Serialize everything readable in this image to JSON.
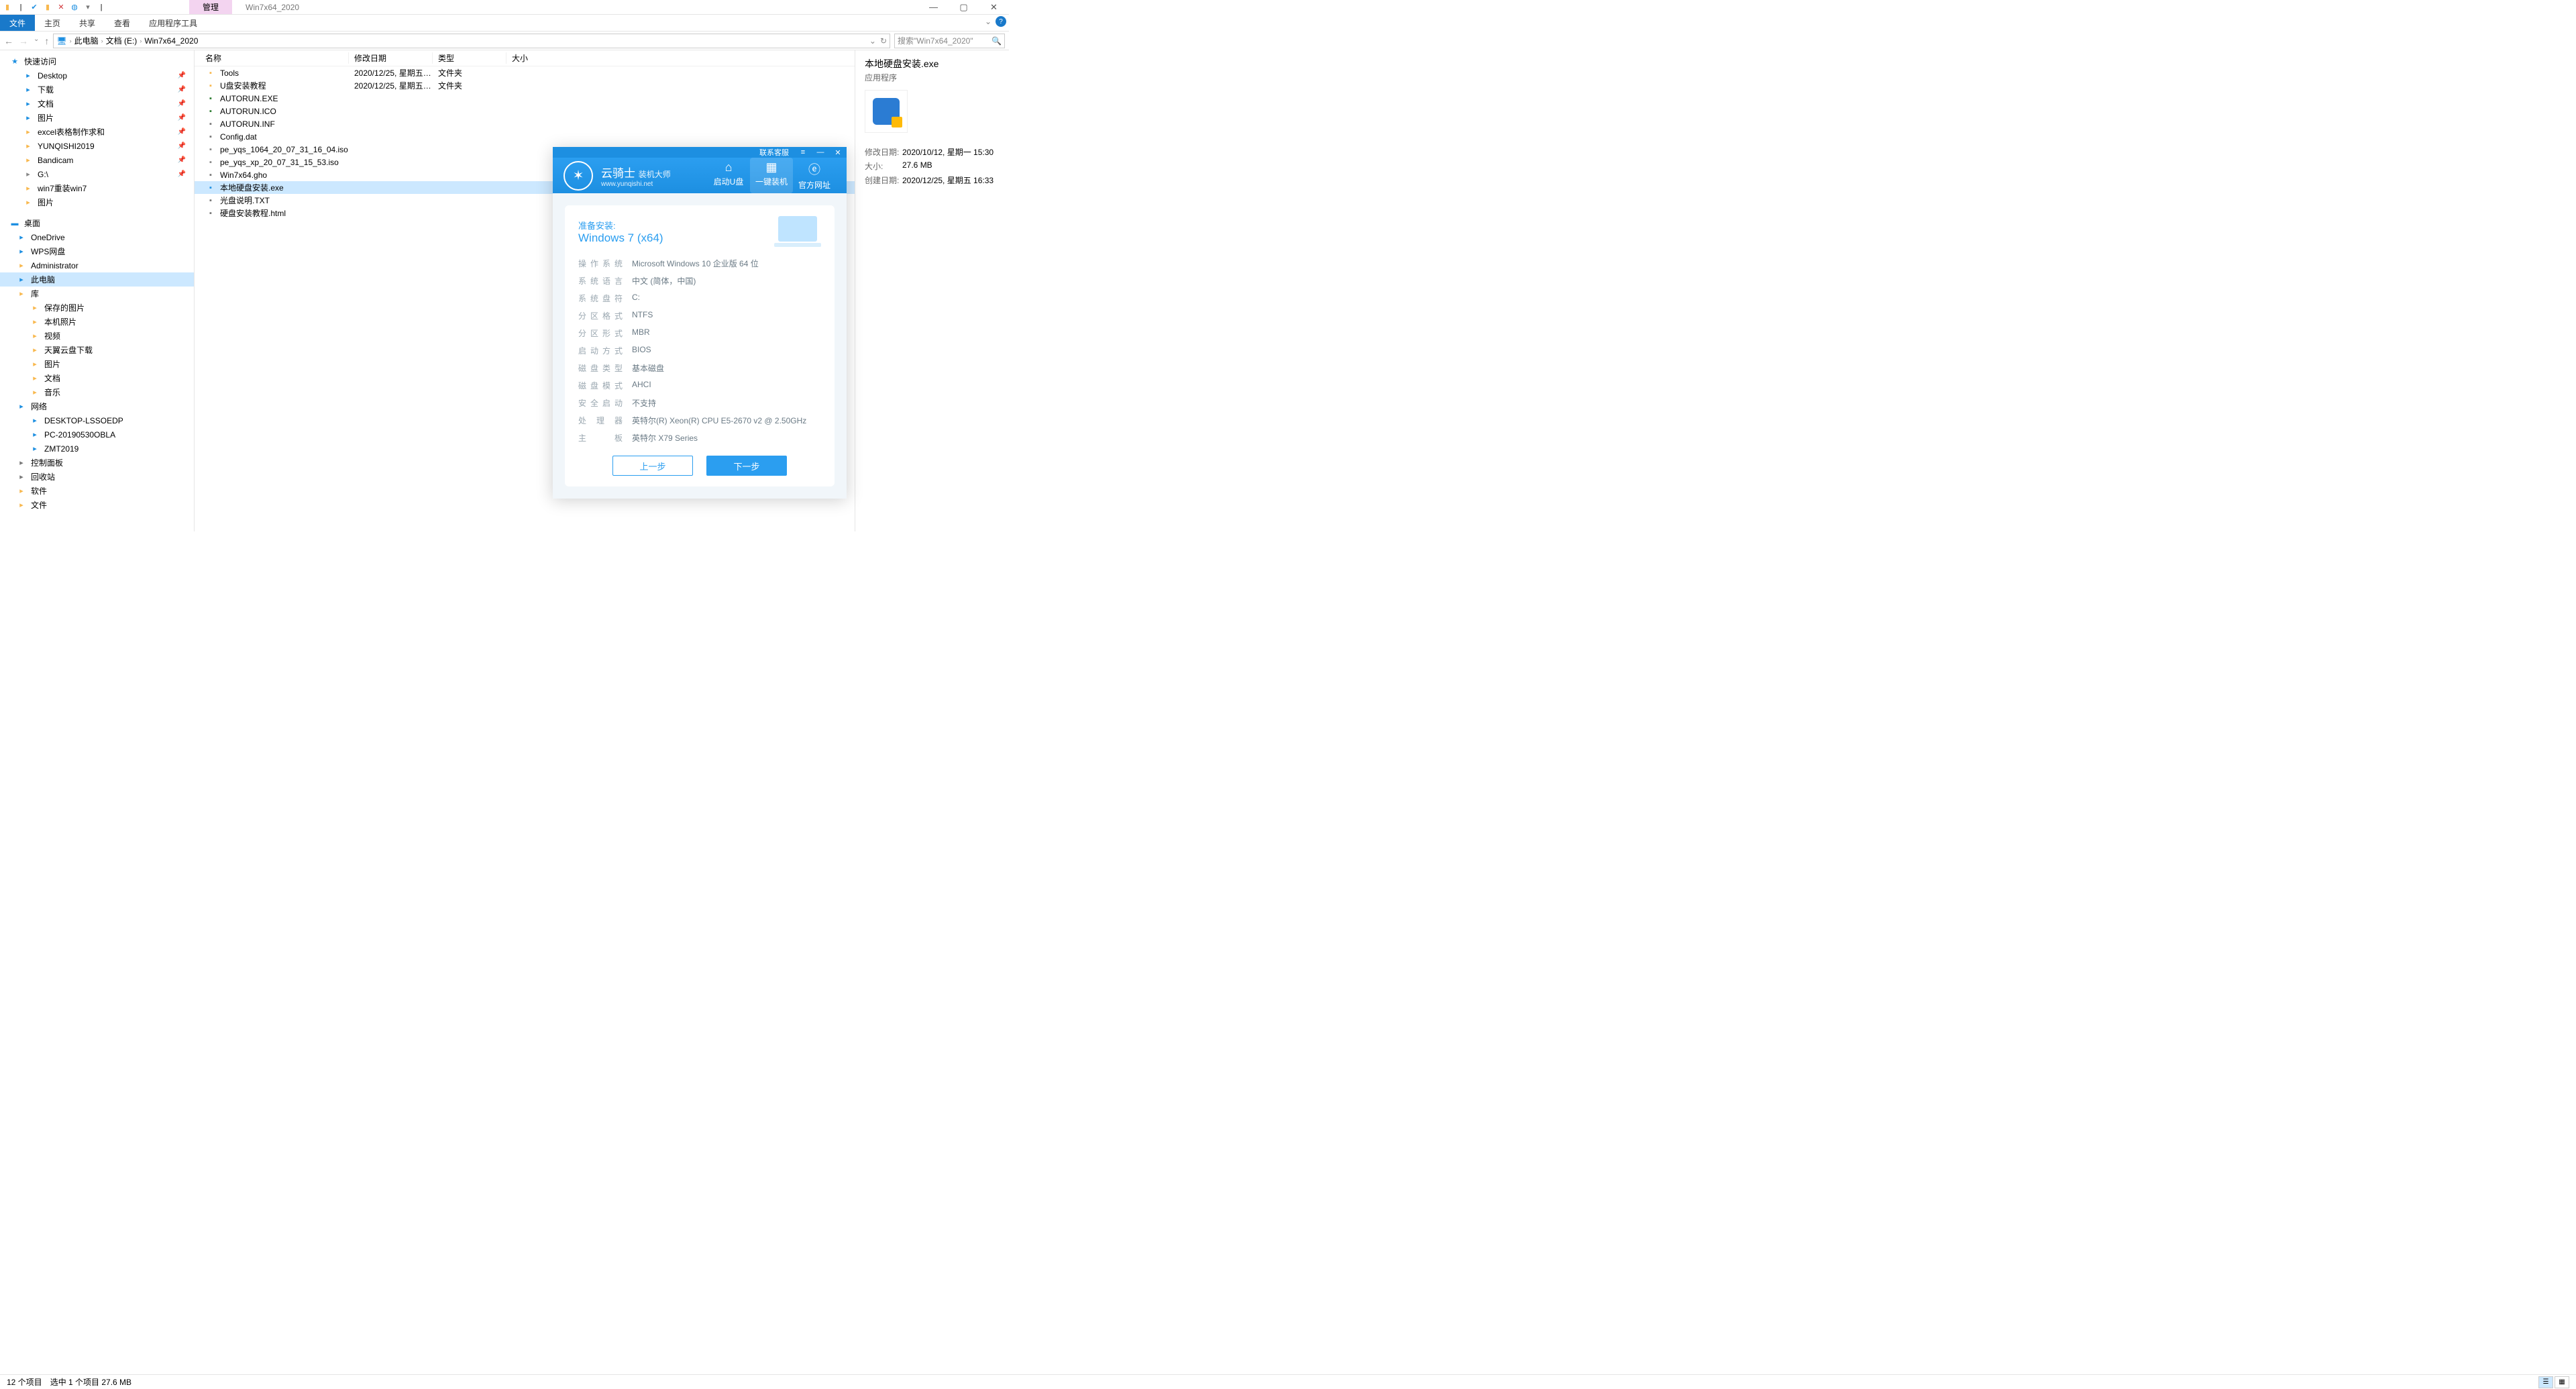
{
  "window": {
    "manage_tab": "管理",
    "title": "Win7x64_2020",
    "qat_icons": [
      "folder-icon",
      "check-icon",
      "x-icon",
      "folder2-icon",
      "save-icon",
      "dropdown-icon"
    ]
  },
  "ribbon": {
    "file": "文件",
    "tabs": [
      "主页",
      "共享",
      "查看",
      "应用程序工具"
    ]
  },
  "address": {
    "segments": [
      "此电脑",
      "文档 (E:)",
      "Win7x64_2020"
    ],
    "search_placeholder": "搜索\"Win7x64_2020\""
  },
  "nav": {
    "quick_access": "快速访问",
    "quick_items": [
      {
        "label": "Desktop",
        "icon": "ic-blue",
        "pin": true
      },
      {
        "label": "下载",
        "icon": "ic-blue",
        "pin": true
      },
      {
        "label": "文档",
        "icon": "ic-blue",
        "pin": true
      },
      {
        "label": "图片",
        "icon": "ic-blue",
        "pin": true
      },
      {
        "label": "excel表格制作求和",
        "icon": "ic-folder",
        "pin": true
      },
      {
        "label": "YUNQISHI2019",
        "icon": "ic-folder",
        "pin": true
      },
      {
        "label": "Bandicam",
        "icon": "ic-folder",
        "pin": true
      },
      {
        "label": "G:\\",
        "icon": "ic-disk",
        "pin": true
      },
      {
        "label": "win7重装win7",
        "icon": "ic-folder",
        "pin": false
      },
      {
        "label": "图片",
        "icon": "ic-folder",
        "pin": false
      }
    ],
    "desktop": "桌面",
    "desktop_items": [
      {
        "label": "OneDrive",
        "icon": "ic-blue"
      },
      {
        "label": "WPS网盘",
        "icon": "ic-blue"
      },
      {
        "label": "Administrator",
        "icon": "ic-folder"
      },
      {
        "label": "此电脑",
        "icon": "ic-monitor",
        "selected": true
      },
      {
        "label": "库",
        "icon": "ic-folder"
      },
      {
        "label": "保存的图片",
        "icon": "ic-folder",
        "sub": true
      },
      {
        "label": "本机照片",
        "icon": "ic-folder",
        "sub": true
      },
      {
        "label": "视频",
        "icon": "ic-folder",
        "sub": true
      },
      {
        "label": "天翼云盘下载",
        "icon": "ic-folder",
        "sub": true
      },
      {
        "label": "图片",
        "icon": "ic-folder",
        "sub": true
      },
      {
        "label": "文档",
        "icon": "ic-folder",
        "sub": true
      },
      {
        "label": "音乐",
        "icon": "ic-folder",
        "sub": true
      },
      {
        "label": "网络",
        "icon": "ic-blue"
      },
      {
        "label": "DESKTOP-LSSOEDP",
        "icon": "ic-monitor",
        "sub": true
      },
      {
        "label": "PC-20190530OBLA",
        "icon": "ic-monitor",
        "sub": true
      },
      {
        "label": "ZMT2019",
        "icon": "ic-monitor",
        "sub": true
      },
      {
        "label": "控制面板",
        "icon": "ic-grey"
      },
      {
        "label": "回收站",
        "icon": "ic-grey"
      },
      {
        "label": "软件",
        "icon": "ic-folder"
      },
      {
        "label": "文件",
        "icon": "ic-folder"
      }
    ]
  },
  "columns": {
    "name": "名称",
    "date": "修改日期",
    "type": "类型",
    "size": "大小"
  },
  "files": [
    {
      "name": "Tools",
      "date": "2020/12/25, 星期五 1...",
      "type": "文件夹",
      "icon": "ic-folder"
    },
    {
      "name": "U盘安装教程",
      "date": "2020/12/25, 星期五 1...",
      "type": "文件夹",
      "icon": "ic-folder"
    },
    {
      "name": "AUTORUN.EXE",
      "icon": "ic-green"
    },
    {
      "name": "AUTORUN.ICO",
      "icon": "ic-green"
    },
    {
      "name": "AUTORUN.INF",
      "icon": "ic-grey"
    },
    {
      "name": "Config.dat",
      "icon": "ic-grey"
    },
    {
      "name": "pe_yqs_1064_20_07_31_16_04.iso",
      "icon": "ic-disk"
    },
    {
      "name": "pe_yqs_xp_20_07_31_15_53.iso",
      "icon": "ic-disk"
    },
    {
      "name": "Win7x64.gho",
      "icon": "ic-grey"
    },
    {
      "name": "本地硬盘安装.exe",
      "icon": "ic-blue",
      "selected": true
    },
    {
      "name": "光盘说明.TXT",
      "icon": "ic-grey"
    },
    {
      "name": "硬盘安装教程.html",
      "icon": "ic-grey"
    }
  ],
  "preview": {
    "title": "本地硬盘安装.exe",
    "subtitle": "应用程序",
    "meta": [
      {
        "l": "修改日期:",
        "v": "2020/10/12, 星期一 15:30"
      },
      {
        "l": "大小:",
        "v": "27.6 MB"
      },
      {
        "l": "创建日期:",
        "v": "2020/12/25, 星期五 16:33"
      }
    ]
  },
  "status": {
    "items": "12 个项目",
    "selected": "选中 1 个项目  27.6 MB"
  },
  "dialog": {
    "contact": "联系客服",
    "brand_cn": "云骑士",
    "brand_sub": "装机大师",
    "brand_url": "www.yunqishi.net",
    "tabs": [
      {
        "l": "启动U盘",
        "i": "⌂"
      },
      {
        "l": "一键装机",
        "i": "▦",
        "active": true
      },
      {
        "l": "官方网址",
        "i": "ⓔ"
      }
    ],
    "prepare": "准备安装:",
    "target": "Windows 7 (x64)",
    "info": [
      {
        "l": "操作系统",
        "v": "Microsoft Windows 10 企业版 64 位"
      },
      {
        "l": "系统语言",
        "v": "中文 (简体，中国)"
      },
      {
        "l": "系统盘符",
        "v": "C:"
      },
      {
        "l": "分区格式",
        "v": "NTFS"
      },
      {
        "l": "分区形式",
        "v": "MBR"
      },
      {
        "l": "启动方式",
        "v": "BIOS"
      },
      {
        "l": "磁盘类型",
        "v": "基本磁盘"
      },
      {
        "l": "磁盘模式",
        "v": "AHCI"
      },
      {
        "l": "安全启动",
        "v": "不支持"
      },
      {
        "l": "处理器",
        "v": "英特尔(R) Xeon(R) CPU E5-2670 v2 @ 2.50GHz"
      },
      {
        "l": "主板",
        "v": "英特尔 X79 Series"
      }
    ],
    "prev": "上一步",
    "next": "下一步"
  }
}
